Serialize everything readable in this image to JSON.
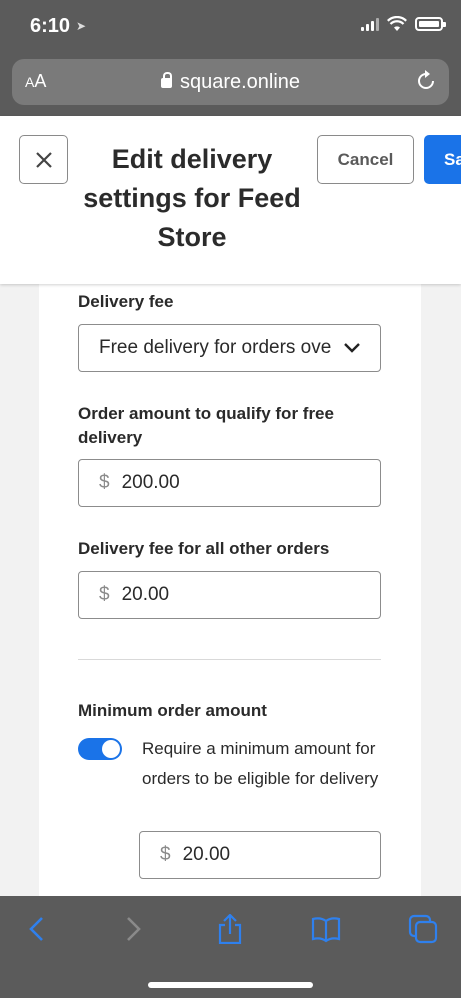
{
  "status_bar": {
    "time": "6:10"
  },
  "browser": {
    "text_size_small": "A",
    "text_size_large": "A",
    "url": "square.online"
  },
  "header": {
    "title": "Edit delivery settings for Feed Store",
    "cancel_label": "Cancel",
    "save_label": "Sa"
  },
  "form": {
    "delivery_fee_label": "Delivery fee",
    "delivery_fee_value": "Free delivery for orders over",
    "qualify_label": "Order amount to qualify for free delivery",
    "qualify_currency": "$",
    "qualify_value": "200.00",
    "other_fee_label": "Delivery fee for all other orders",
    "other_fee_currency": "$",
    "other_fee_value": "20.00",
    "minimum_label": "Minimum order amount",
    "minimum_toggle_on": true,
    "minimum_toggle_text": "Require a minimum amount for orders to be eligible for delivery",
    "minimum_currency": "$",
    "minimum_value": "20.00"
  },
  "colors": {
    "accent": "#1a73e8",
    "chrome": "#5b5b5b"
  },
  "toolbar": {
    "icons": [
      "back-icon",
      "forward-icon",
      "share-icon",
      "bookmarks-icon",
      "tabs-icon"
    ]
  }
}
